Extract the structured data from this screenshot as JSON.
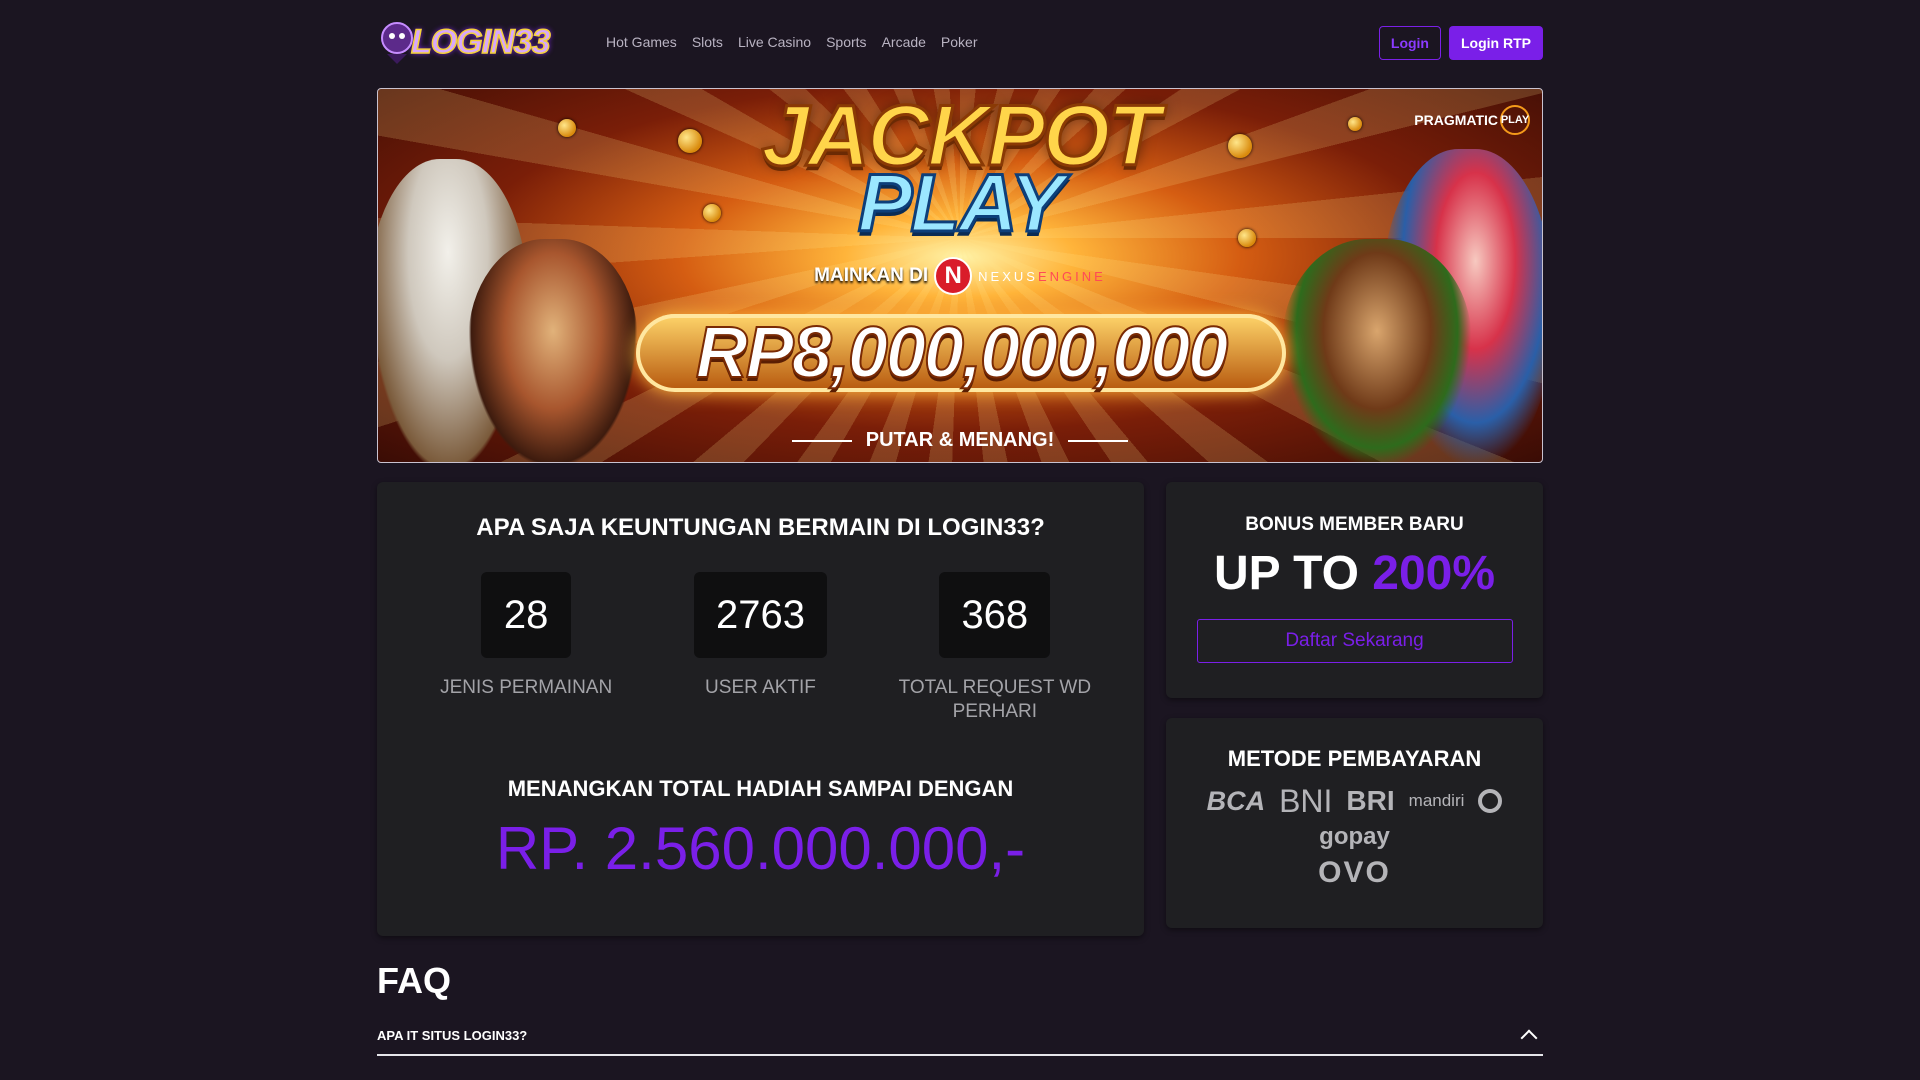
{
  "header": {
    "logo_text": "LOGIN33",
    "nav": [
      "Hot Games",
      "Slots",
      "Live Casino",
      "Sports",
      "Arcade",
      "Poker"
    ],
    "login_label": "Login",
    "login_rtp_label": "Login RTP"
  },
  "banner": {
    "line1": "JACKPOT",
    "line2": "PLAY",
    "mainkan": "MAINKAN DI",
    "engine_logo": "N",
    "engine_name_a": "NEXUS",
    "engine_name_b": "ENGINE",
    "amount": "RP8,000,000,000",
    "tagline": "PUTAR & MENANG!",
    "provider_a": "PRAGMATIC",
    "provider_b": "PLAY"
  },
  "stats_panel": {
    "heading": "APA SAJA KEUNTUNGAN BERMAIN DI LOGIN33?",
    "stats": [
      {
        "value": "28",
        "label": "JENIS PERMAINAN"
      },
      {
        "value": "2763",
        "label": "USER AKTIF"
      },
      {
        "value": "368",
        "label": "TOTAL REQUEST WD PERHARI"
      }
    ],
    "win_heading": "MENANGKAN TOTAL HADIAH SAMPAI DENGAN",
    "win_value": "RP. 2.560.000.000,-"
  },
  "bonus": {
    "title": "BONUS MEMBER BARU",
    "up_to": "UP TO",
    "percent": "200%",
    "cta": "Daftar Sekarang"
  },
  "payment": {
    "title": "METODE PEMBAYARAN",
    "methods": [
      "BCA",
      "BNI",
      "BRI",
      "mandiri",
      "gopay",
      "OVO"
    ]
  },
  "faq": {
    "title": "FAQ",
    "items": [
      {
        "question": "APA IT SITUS LOGIN33?"
      }
    ]
  },
  "colors": {
    "accent": "#7a1fe8",
    "background": "#1b1521",
    "panel": "#1f1f22"
  }
}
